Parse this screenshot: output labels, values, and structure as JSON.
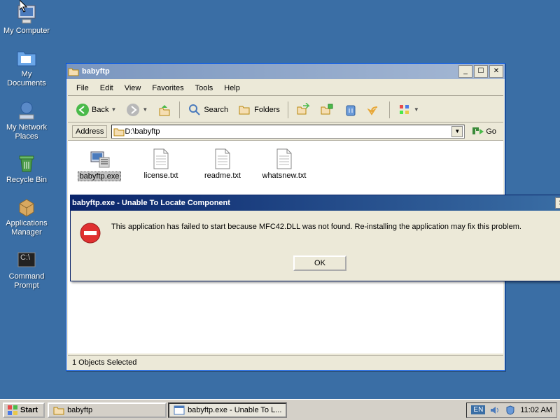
{
  "desktop": {
    "icons": [
      {
        "label": "My Computer"
      },
      {
        "label": "My Documents"
      },
      {
        "label": "My Network Places"
      },
      {
        "label": "Recycle Bin"
      },
      {
        "label": "Applications Manager"
      },
      {
        "label": "Command Prompt"
      }
    ]
  },
  "explorer": {
    "title": "babyftp",
    "menu": [
      "File",
      "Edit",
      "View",
      "Favorites",
      "Tools",
      "Help"
    ],
    "toolbar": {
      "back": "Back",
      "search": "Search",
      "folders": "Folders"
    },
    "address_label": "Address",
    "address_value": "D:\\babyftp",
    "go_label": "Go",
    "files": [
      {
        "name": "babyftp.exe",
        "type": "exe",
        "selected": true
      },
      {
        "name": "license.txt",
        "type": "txt",
        "selected": false
      },
      {
        "name": "readme.txt",
        "type": "txt",
        "selected": false
      },
      {
        "name": "whatsnew.txt",
        "type": "txt",
        "selected": false
      }
    ],
    "status": "1 Objects Selected"
  },
  "dialog": {
    "title": "babyftp.exe - Unable To Locate Component",
    "message": "This application has failed to start because MFC42.DLL was not found. Re-installing the application may fix this problem.",
    "ok": "OK"
  },
  "taskbar": {
    "start": "Start",
    "tasks": [
      {
        "label": "babyftp",
        "active": false
      },
      {
        "label": "babyftp.exe - Unable To L...",
        "active": true
      }
    ],
    "lang": "EN",
    "clock": "11:02 AM"
  }
}
